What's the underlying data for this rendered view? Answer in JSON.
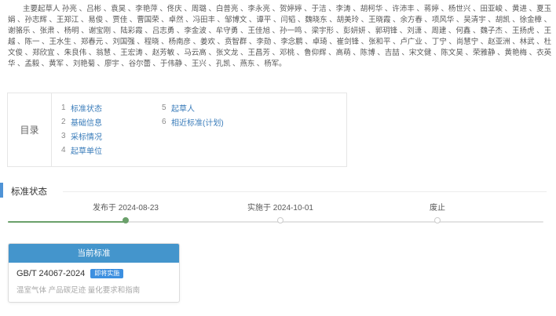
{
  "drafters": {
    "text": "主要起草人 孙亮 、吕彬 、袁昊 、李艳萍 、佟庆 、周璐 、白普亮 、李永亮 、贺婷婷 、于洁 、李涛 、胡柯华 、许沛丰 、蒋婷 、杨世兴 、田亚峻 、黄进 、夏玉娟 、孙志辉 、王郑江 、易俊 、贾佳 、曹国荣 、卓然 、冯田丰 、邹博文 、谭平 、闫韬 、魏晓东 、胡美玲 、王晓霞 、余方春 、项风华 、吴清宇 、胡凯 、徐金樟 、谢骆乐 、张肃 、杨明 、谢宝刚 、陆彩霞 、吕志勇 、李金波 、牟守勇 、王佳旭 、孙一鸣 、梁宇形 、彭妍妍 、郭玥锋 、刘潇 、周建 、何鑫 、魏子杰 、王扬虎 、王越 、陈一 、王水生 、郑春元 、刘国强 、程晓 、杨南彦 、姜欢 、贲智群 、李勋 、李念鹏 、卓琦 、崔剑锋 、张和平 、卢广业 、丁宁 、尚慧宁 、赵亚洲 、林武 、杜文俊 、郑欣宜 、朱良伟 、翁慧 、王宏涛 、赵芳敏 、马云高 、张文龙 、王昌芳 、邓桃 、鲁仰辉 、高萌 、陈博 、吉喆 、宋文健 、陈文昊 、荣雅静 、黄艳梅 、衣英华 、孟毅 、黄军 、刘艳菊 、廖宇 、谷尔蕾 、于伟静 、王兴 、孔凯 、燕东 、杨军。"
  },
  "toc": {
    "heading": "目录",
    "items": [
      {
        "num": "1",
        "label": "标准状态"
      },
      {
        "num": "2",
        "label": "基础信息"
      },
      {
        "num": "3",
        "label": "采标情况"
      },
      {
        "num": "4",
        "label": "起草单位"
      },
      {
        "num": "5",
        "label": "起草人"
      },
      {
        "num": "6",
        "label": "相近标准(计划)"
      }
    ]
  },
  "section": {
    "title": "标准状态"
  },
  "timeline": {
    "stages": [
      {
        "label": "发布于 2024-08-23",
        "state": "done"
      },
      {
        "label": "实施于 2024-10-01",
        "state": "pending"
      },
      {
        "label": "废止",
        "state": "pending"
      }
    ]
  },
  "card": {
    "header": "当前标准",
    "code": "GB/T 24067-2024",
    "badge": "即将实施",
    "name": "温室气体 产品碳足迹 量化要求和指南"
  },
  "colors": {
    "accent_blue": "#4f93d6",
    "link_blue": "#3a7cba",
    "header_blue": "#4495cc",
    "badge_blue": "#3c8fe0",
    "progress_green": "#6aa06a"
  }
}
